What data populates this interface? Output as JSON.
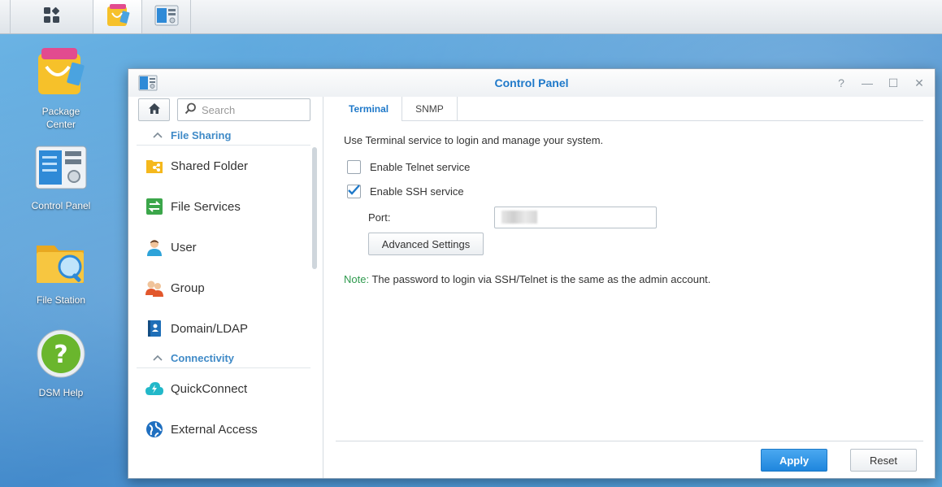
{
  "taskbar": {
    "items": [
      {
        "icon": "main-menu-icon"
      },
      {
        "icon": "package-center-icon"
      },
      {
        "icon": "control-panel-icon"
      }
    ]
  },
  "desktop": {
    "icons": [
      {
        "label": "Package Center",
        "icon": "package-center-icon"
      },
      {
        "label": "Control Panel",
        "icon": "control-panel-icon"
      },
      {
        "label": "File Station",
        "icon": "file-station-icon"
      },
      {
        "label": "DSM Help",
        "icon": "help-icon"
      }
    ]
  },
  "window": {
    "title": "Control Panel",
    "controls": [
      "?",
      "—",
      "☐",
      "✕"
    ]
  },
  "sidebar": {
    "search_placeholder": "Search",
    "sections": [
      {
        "label": "File Sharing",
        "items": [
          {
            "label": "Shared Folder",
            "icon": "shared-folder-icon"
          },
          {
            "label": "File Services",
            "icon": "file-services-icon"
          },
          {
            "label": "User",
            "icon": "user-icon"
          },
          {
            "label": "Group",
            "icon": "group-icon"
          },
          {
            "label": "Domain/LDAP",
            "icon": "domain-ldap-icon"
          }
        ]
      },
      {
        "label": "Connectivity",
        "items": [
          {
            "label": "QuickConnect",
            "icon": "quickconnect-icon"
          },
          {
            "label": "External Access",
            "icon": "external-access-icon"
          }
        ]
      }
    ]
  },
  "content": {
    "tabs": [
      {
        "label": "Terminal",
        "active": true
      },
      {
        "label": "SNMP",
        "active": false
      }
    ],
    "description": "Use Terminal service to login and manage your system.",
    "telnet": {
      "label": "Enable Telnet service",
      "checked": false
    },
    "ssh": {
      "label": "Enable SSH service",
      "checked": true
    },
    "port": {
      "label": "Port:",
      "value": ""
    },
    "advanced_button": "Advanced Settings",
    "note": {
      "key": "Note:",
      "text": " The password to login via SSH/Telnet is the same as the admin account."
    },
    "apply_button": "Apply",
    "reset_button": "Reset"
  },
  "colors": {
    "accent": "#1f79c9",
    "apply_button": "#2a90e4",
    "note_key": "#2f9a4e"
  }
}
